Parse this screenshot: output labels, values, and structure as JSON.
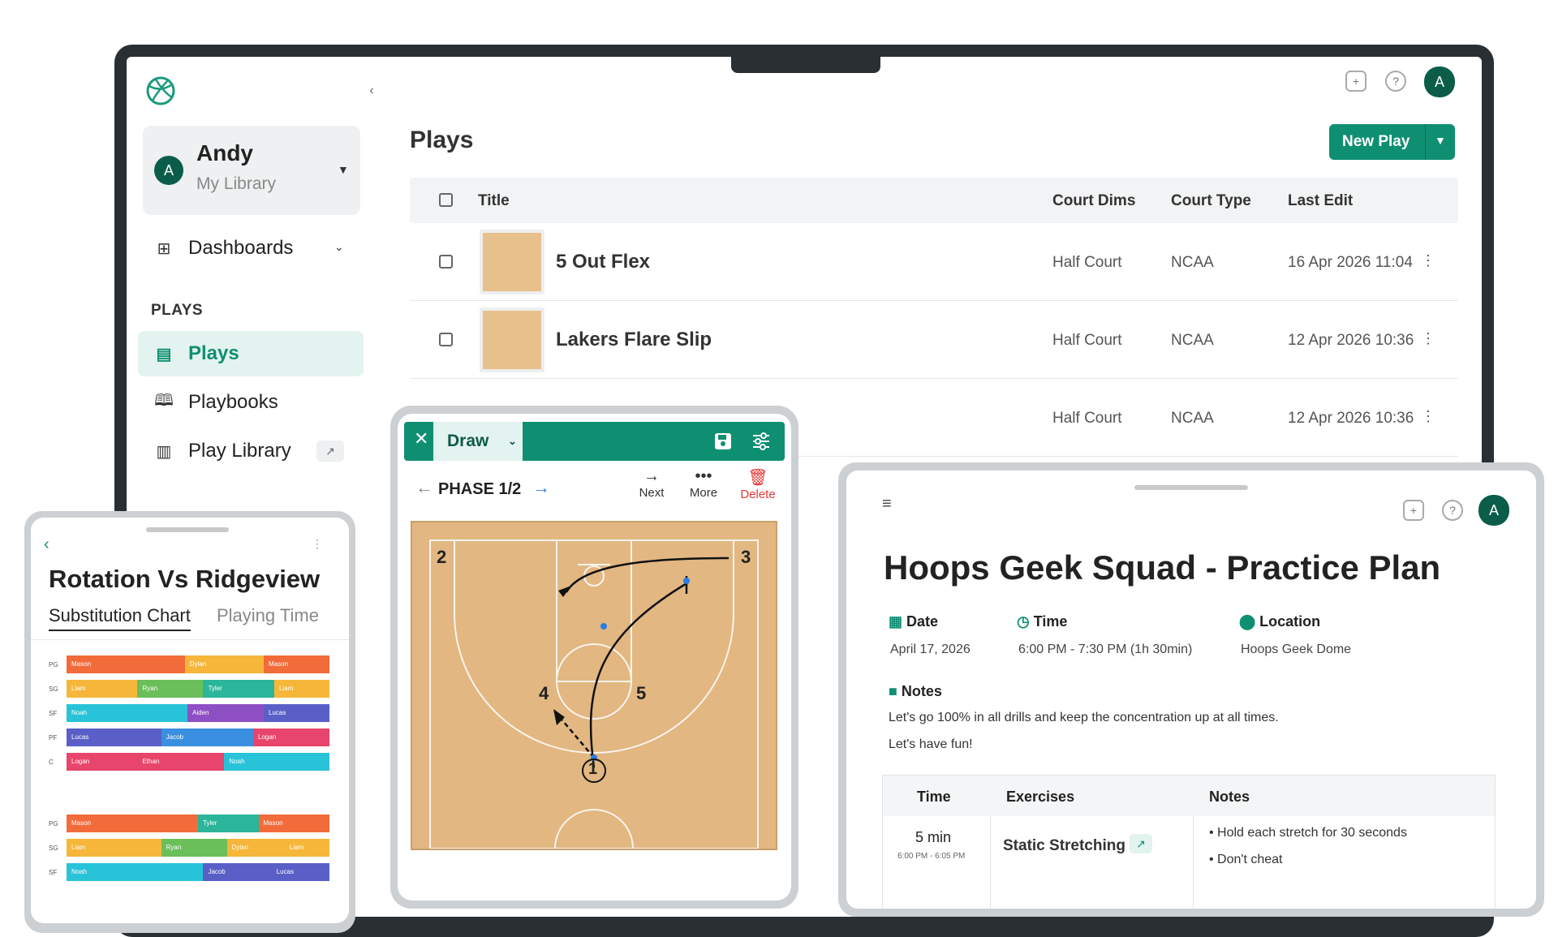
{
  "laptop": {
    "sidebar": {
      "user_name": "Andy",
      "user_subtitle": "My Library",
      "user_initial": "A",
      "dashboards_label": "Dashboards",
      "section_label": "PLAYS",
      "items": [
        {
          "label": "Plays",
          "icon": "document-icon"
        },
        {
          "label": "Playbooks",
          "icon": "book-icon"
        },
        {
          "label": "Play Library",
          "icon": "library-icon"
        }
      ]
    },
    "topbar": {
      "avatar_initial": "A"
    },
    "page_title": "Plays",
    "new_play_label": "New Play",
    "table": {
      "headers": [
        "Title",
        "Court Dims",
        "Court Type",
        "Last Edit"
      ],
      "rows": [
        {
          "title": "5 Out Flex",
          "dims": "Half Court",
          "type": "NCAA",
          "edited": "16 Apr 2026 11:04"
        },
        {
          "title": "Lakers Flare Slip",
          "dims": "Half Court",
          "type": "NCAA",
          "edited": "12 Apr 2026 10:36"
        },
        {
          "title": "",
          "dims": "Half Court",
          "type": "NCAA",
          "edited": "12 Apr 2026 10:36"
        }
      ]
    }
  },
  "rotation": {
    "title": "Rotation Vs Ridgeview",
    "tabs": [
      "Substitution Chart",
      "Playing Time"
    ],
    "colors": {
      "orange": "#f26b3a",
      "yellow": "#f6b63a",
      "green": "#6bbf5a",
      "teal": "#2bb59a",
      "cyan": "#28c3d8",
      "purple": "#8e4fc4",
      "indigo": "#5a5fc7",
      "blue": "#3a8fe0",
      "pink": "#e8456c"
    },
    "chart1": [
      {
        "pos": "PG",
        "segs": [
          {
            "name": "Mason",
            "w": 0.45,
            "c": "orange"
          },
          {
            "name": "Dylan",
            "w": 0.3,
            "c": "yellow"
          },
          {
            "name": "Mason",
            "w": 0.25,
            "c": "orange"
          }
        ]
      },
      {
        "pos": "SG",
        "segs": [
          {
            "name": "Liam",
            "w": 0.27,
            "c": "yellow"
          },
          {
            "name": "Ryan",
            "w": 0.25,
            "c": "green"
          },
          {
            "name": "Tyler",
            "w": 0.27,
            "c": "teal"
          },
          {
            "name": "Liam",
            "w": 0.21,
            "c": "yellow"
          }
        ]
      },
      {
        "pos": "SF",
        "segs": [
          {
            "name": "Noah",
            "w": 0.46,
            "c": "cyan"
          },
          {
            "name": "Aiden",
            "w": 0.29,
            "c": "purple"
          },
          {
            "name": "Lucas",
            "w": 0.25,
            "c": "indigo"
          }
        ]
      },
      {
        "pos": "PF",
        "segs": [
          {
            "name": "Lucas",
            "w": 0.36,
            "c": "indigo"
          },
          {
            "name": "Jacob",
            "w": 0.35,
            "c": "blue"
          },
          {
            "name": "Logan",
            "w": 0.29,
            "c": "pink"
          }
        ]
      },
      {
        "pos": "C",
        "segs": [
          {
            "name": "Logan",
            "w": 0.27,
            "c": "pink"
          },
          {
            "name": "Ethan",
            "w": 0.33,
            "c": "pink"
          },
          {
            "name": "Noah",
            "w": 0.4,
            "c": "cyan"
          }
        ]
      }
    ],
    "chart2": [
      {
        "pos": "PG",
        "segs": [
          {
            "name": "Mason",
            "w": 0.5,
            "c": "orange"
          },
          {
            "name": "Tyler",
            "w": 0.23,
            "c": "teal"
          },
          {
            "name": "Mason",
            "w": 0.27,
            "c": "orange"
          }
        ]
      },
      {
        "pos": "SG",
        "segs": [
          {
            "name": "Liam",
            "w": 0.36,
            "c": "yellow"
          },
          {
            "name": "Ryan",
            "w": 0.25,
            "c": "green"
          },
          {
            "name": "Dylan",
            "w": 0.22,
            "c": "yellow"
          },
          {
            "name": "Liam",
            "w": 0.17,
            "c": "yellow"
          }
        ]
      },
      {
        "pos": "SF",
        "segs": [
          {
            "name": "Noah",
            "w": 0.52,
            "c": "cyan"
          },
          {
            "name": "Jacob",
            "w": 0.26,
            "c": "indigo"
          },
          {
            "name": "Lucas",
            "w": 0.22,
            "c": "indigo"
          }
        ]
      }
    ]
  },
  "draw": {
    "mode_label": "Draw",
    "phase_label": "PHASE 1/2",
    "actions": [
      {
        "label": "Next",
        "icon": "arrow-right-icon"
      },
      {
        "label": "More",
        "icon": "more-dots-icon"
      },
      {
        "label": "Delete",
        "icon": "trash-icon"
      }
    ],
    "players": [
      "1",
      "2",
      "3",
      "4",
      "5"
    ]
  },
  "practice": {
    "title": "Hoops Geek Squad - Practice Plan",
    "avatar_initial": "A",
    "date_label": "Date",
    "date_value": "April 17, 2026",
    "time_label": "Time",
    "time_value": "6:00 PM - 7:30 PM (1h 30min)",
    "location_label": "Location",
    "location_value": "Hoops Geek Dome",
    "notes_label": "Notes",
    "notes": [
      "Let's go 100% in all drills and keep the concentration up at all times.",
      "Let's have fun!"
    ],
    "table": {
      "headers": [
        "Time",
        "Exercises",
        "Notes"
      ],
      "row": {
        "duration": "5 min",
        "range": "6:00 PM - 6:05 PM",
        "exercise": "Static Stretching",
        "notes": [
          "Hold each stretch for 30 seconds",
          "Don't cheat"
        ]
      }
    }
  }
}
